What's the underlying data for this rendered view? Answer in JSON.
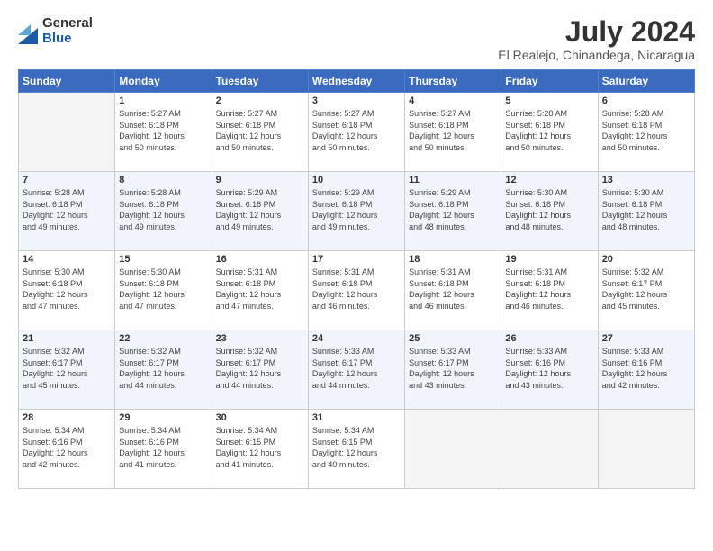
{
  "header": {
    "logo_general": "General",
    "logo_blue": "Blue",
    "title": "July 2024",
    "subtitle": "El Realejo, Chinandega, Nicaragua"
  },
  "weekdays": [
    "Sunday",
    "Monday",
    "Tuesday",
    "Wednesday",
    "Thursday",
    "Friday",
    "Saturday"
  ],
  "weeks": [
    [
      {
        "day": "",
        "info": ""
      },
      {
        "day": "1",
        "info": "Sunrise: 5:27 AM\nSunset: 6:18 PM\nDaylight: 12 hours\nand 50 minutes."
      },
      {
        "day": "2",
        "info": "Sunrise: 5:27 AM\nSunset: 6:18 PM\nDaylight: 12 hours\nand 50 minutes."
      },
      {
        "day": "3",
        "info": "Sunrise: 5:27 AM\nSunset: 6:18 PM\nDaylight: 12 hours\nand 50 minutes."
      },
      {
        "day": "4",
        "info": "Sunrise: 5:27 AM\nSunset: 6:18 PM\nDaylight: 12 hours\nand 50 minutes."
      },
      {
        "day": "5",
        "info": "Sunrise: 5:28 AM\nSunset: 6:18 PM\nDaylight: 12 hours\nand 50 minutes."
      },
      {
        "day": "6",
        "info": "Sunrise: 5:28 AM\nSunset: 6:18 PM\nDaylight: 12 hours\nand 50 minutes."
      }
    ],
    [
      {
        "day": "7",
        "info": "Sunrise: 5:28 AM\nSunset: 6:18 PM\nDaylight: 12 hours\nand 49 minutes."
      },
      {
        "day": "8",
        "info": "Sunrise: 5:28 AM\nSunset: 6:18 PM\nDaylight: 12 hours\nand 49 minutes."
      },
      {
        "day": "9",
        "info": "Sunrise: 5:29 AM\nSunset: 6:18 PM\nDaylight: 12 hours\nand 49 minutes."
      },
      {
        "day": "10",
        "info": "Sunrise: 5:29 AM\nSunset: 6:18 PM\nDaylight: 12 hours\nand 49 minutes."
      },
      {
        "day": "11",
        "info": "Sunrise: 5:29 AM\nSunset: 6:18 PM\nDaylight: 12 hours\nand 48 minutes."
      },
      {
        "day": "12",
        "info": "Sunrise: 5:30 AM\nSunset: 6:18 PM\nDaylight: 12 hours\nand 48 minutes."
      },
      {
        "day": "13",
        "info": "Sunrise: 5:30 AM\nSunset: 6:18 PM\nDaylight: 12 hours\nand 48 minutes."
      }
    ],
    [
      {
        "day": "14",
        "info": "Sunrise: 5:30 AM\nSunset: 6:18 PM\nDaylight: 12 hours\nand 47 minutes."
      },
      {
        "day": "15",
        "info": "Sunrise: 5:30 AM\nSunset: 6:18 PM\nDaylight: 12 hours\nand 47 minutes."
      },
      {
        "day": "16",
        "info": "Sunrise: 5:31 AM\nSunset: 6:18 PM\nDaylight: 12 hours\nand 47 minutes."
      },
      {
        "day": "17",
        "info": "Sunrise: 5:31 AM\nSunset: 6:18 PM\nDaylight: 12 hours\nand 46 minutes."
      },
      {
        "day": "18",
        "info": "Sunrise: 5:31 AM\nSunset: 6:18 PM\nDaylight: 12 hours\nand 46 minutes."
      },
      {
        "day": "19",
        "info": "Sunrise: 5:31 AM\nSunset: 6:18 PM\nDaylight: 12 hours\nand 46 minutes."
      },
      {
        "day": "20",
        "info": "Sunrise: 5:32 AM\nSunset: 6:17 PM\nDaylight: 12 hours\nand 45 minutes."
      }
    ],
    [
      {
        "day": "21",
        "info": "Sunrise: 5:32 AM\nSunset: 6:17 PM\nDaylight: 12 hours\nand 45 minutes."
      },
      {
        "day": "22",
        "info": "Sunrise: 5:32 AM\nSunset: 6:17 PM\nDaylight: 12 hours\nand 44 minutes."
      },
      {
        "day": "23",
        "info": "Sunrise: 5:32 AM\nSunset: 6:17 PM\nDaylight: 12 hours\nand 44 minutes."
      },
      {
        "day": "24",
        "info": "Sunrise: 5:33 AM\nSunset: 6:17 PM\nDaylight: 12 hours\nand 44 minutes."
      },
      {
        "day": "25",
        "info": "Sunrise: 5:33 AM\nSunset: 6:17 PM\nDaylight: 12 hours\nand 43 minutes."
      },
      {
        "day": "26",
        "info": "Sunrise: 5:33 AM\nSunset: 6:16 PM\nDaylight: 12 hours\nand 43 minutes."
      },
      {
        "day": "27",
        "info": "Sunrise: 5:33 AM\nSunset: 6:16 PM\nDaylight: 12 hours\nand 42 minutes."
      }
    ],
    [
      {
        "day": "28",
        "info": "Sunrise: 5:34 AM\nSunset: 6:16 PM\nDaylight: 12 hours\nand 42 minutes."
      },
      {
        "day": "29",
        "info": "Sunrise: 5:34 AM\nSunset: 6:16 PM\nDaylight: 12 hours\nand 41 minutes."
      },
      {
        "day": "30",
        "info": "Sunrise: 5:34 AM\nSunset: 6:15 PM\nDaylight: 12 hours\nand 41 minutes."
      },
      {
        "day": "31",
        "info": "Sunrise: 5:34 AM\nSunset: 6:15 PM\nDaylight: 12 hours\nand 40 minutes."
      },
      {
        "day": "",
        "info": ""
      },
      {
        "day": "",
        "info": ""
      },
      {
        "day": "",
        "info": ""
      }
    ]
  ]
}
